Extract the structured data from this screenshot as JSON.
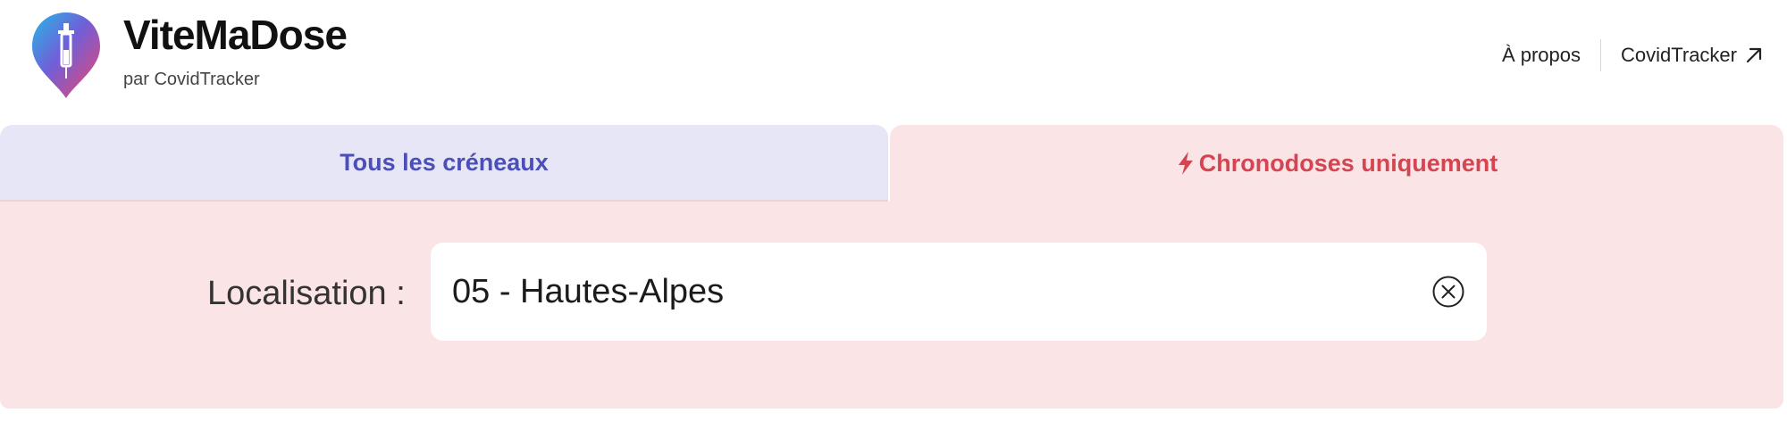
{
  "header": {
    "brand_title": "ViteMaDose",
    "brand_subtitle": "par CovidTracker",
    "nav": {
      "about_label": "À propos",
      "covidtracker_label": "CovidTracker"
    }
  },
  "tabs": {
    "all_slots_label": "Tous les créneaux",
    "chronodoses_label": "Chronodoses uniquement",
    "active": "chronodoses"
  },
  "search": {
    "label": "Localisation :",
    "value": "05 - Hautes-Alpes"
  },
  "icons": {
    "logo": "syringe-pin-logo",
    "external_link": "arrow-up-right-icon",
    "chronodose": "lightning-bolt-icon",
    "clear": "clear-circle-x-icon"
  },
  "colors": {
    "tab_all_bg": "#e6e6f7",
    "tab_all_text": "#4b4fb7",
    "tab_chrono_bg": "#fbe4e6",
    "tab_chrono_text": "#d44552"
  }
}
